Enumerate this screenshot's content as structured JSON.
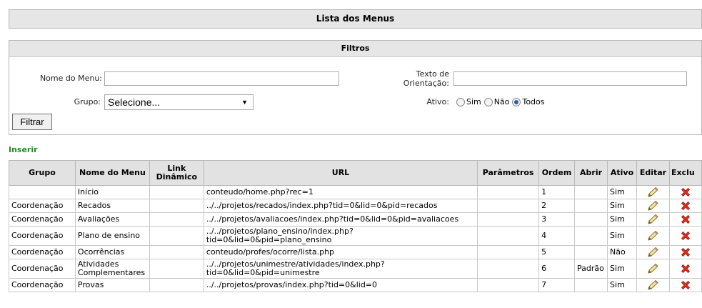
{
  "page_title": "Lista dos Menus",
  "filters": {
    "heading": "Filtros",
    "menu_name_label": "Nome do Menu:",
    "orientation_label_1": "Texto de",
    "orientation_label_2": "Orientação:",
    "group_label": "Grupo:",
    "group_selected": "Selecione...",
    "active_label": "Ativo:",
    "active_options": [
      "Sim",
      "Não",
      "Todos"
    ],
    "active_selected": "Todos",
    "filter_button": "Filtrar"
  },
  "insert_link": "Inserir",
  "table": {
    "headers": [
      "Grupo",
      "Nome do Menu",
      "Link Dinâmico",
      "URL",
      "Parâmetros",
      "Ordem",
      "Abrir",
      "Ativo",
      "Editar",
      "Exclu"
    ],
    "rows": [
      {
        "grupo": "",
        "nome": "Início",
        "link": "",
        "url": "conteudo/home.php?rec=1",
        "param": "",
        "ordem": "1",
        "abrir": "",
        "ativo": "Sim"
      },
      {
        "grupo": "Coordenação",
        "nome": "Recados",
        "link": "",
        "url": "../../projetos/recados/index.php?tid=0&lid=0&pid=recados",
        "param": "",
        "ordem": "2",
        "abrir": "",
        "ativo": "Sim"
      },
      {
        "grupo": "Coordenação",
        "nome": "Avaliações",
        "link": "",
        "url": "../../projetos/avaliacoes/index.php?tid=0&lid=0&pid=avaliacoes",
        "param": "",
        "ordem": "3",
        "abrir": "",
        "ativo": "Sim"
      },
      {
        "grupo": "Coordenação",
        "nome": "Plano de ensino",
        "link": "",
        "url": "../../projetos/plano_ensino/index.php?\ntid=0&lid=0&pid=plano_ensino",
        "param": "",
        "ordem": "4",
        "abrir": "",
        "ativo": "Sim"
      },
      {
        "grupo": "Coordenação",
        "nome": "Ocorrências",
        "link": "",
        "url": "conteudo/profes/ocorre/lista.php",
        "param": "",
        "ordem": "5",
        "abrir": "",
        "ativo": "Não"
      },
      {
        "grupo": "Coordenação",
        "nome": "Atividades\nComplementares",
        "link": "",
        "url": "../../projetos/unimestre/atividades/index.php?\ntid=0&lid=0&pid=unimestre",
        "param": "",
        "ordem": "6",
        "abrir": "Padrão",
        "ativo": "Sim"
      },
      {
        "grupo": "Coordenação",
        "nome": "Provas",
        "link": "",
        "url": "../../projetos/provas/index.php?tid=0&lid=0",
        "param": "",
        "ordem": "7",
        "abrir": "",
        "ativo": "Sim"
      }
    ]
  },
  "icons": {
    "edit": "pencil-icon",
    "delete": "red-x-delete-icon"
  },
  "colors": {
    "insert_link": "#2a8a2a",
    "delete_icon": "#d8301f",
    "radio_selected": "#2a5db0"
  }
}
